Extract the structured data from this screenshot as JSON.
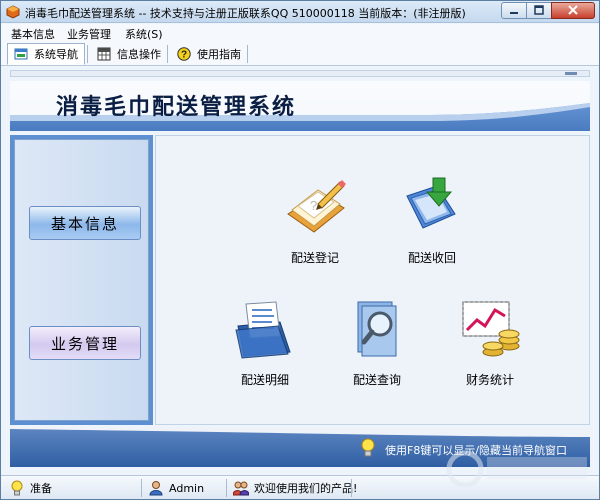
{
  "window": {
    "title": "消毒毛巾配送管理系统 -- 技术支持与注册正版联系QQ 510000118   当前版本：(非注册版)"
  },
  "menu": {
    "items": [
      {
        "label": "基本信息"
      },
      {
        "label": "业务管理"
      },
      {
        "label": "系统(S)"
      }
    ]
  },
  "tabs": [
    {
      "label": "系统导航",
      "active": true
    },
    {
      "label": "信息操作",
      "active": false
    },
    {
      "label": "使用指南",
      "active": false
    }
  ],
  "header": {
    "title": "消毒毛巾配送管理系统"
  },
  "nav": {
    "basic_info": "基本信息",
    "business_mgmt": "业务管理"
  },
  "functions": [
    {
      "label": "配送登记",
      "icon": "register-icon"
    },
    {
      "label": "配送收回",
      "icon": "recover-icon"
    },
    {
      "label": "配送明细",
      "icon": "detail-icon"
    },
    {
      "label": "配送查询",
      "icon": "search-icon"
    },
    {
      "label": "财务统计",
      "icon": "finance-icon"
    }
  ],
  "hint": {
    "text": "使用F8键可以显示/隐藏当前导航窗口"
  },
  "status": {
    "state": "准备",
    "user": "Admin",
    "welcome": "欢迎使用我们的产品!"
  },
  "colors": {
    "header_blue": "#5f8fcf",
    "hint_bar": "#2f5ea3",
    "nav_button_blue": "#8db8ea",
    "nav_button_lilac": "#d4c9ef"
  }
}
